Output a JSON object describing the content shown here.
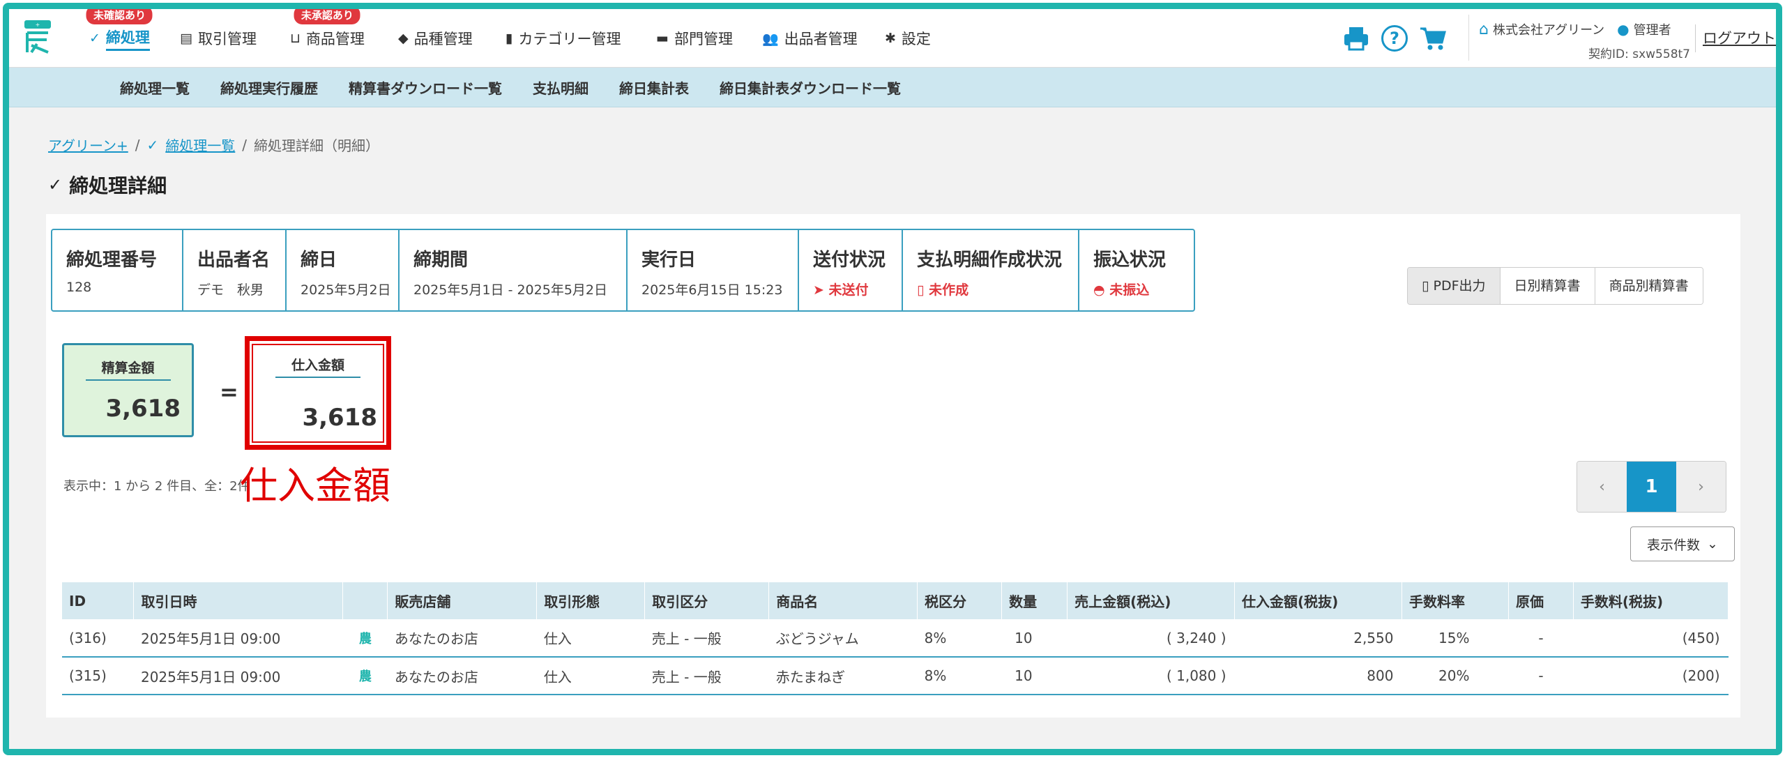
{
  "nav": {
    "items": [
      {
        "label": "締処理",
        "badge": "未確認あり",
        "icon": "check-circle-icon"
      },
      {
        "label": "取引管理",
        "badge": "",
        "icon": "list-icon"
      },
      {
        "label": "商品管理",
        "badge": "未承認あり",
        "icon": "basket-icon"
      },
      {
        "label": "品種管理",
        "badge": "",
        "icon": "tag-icon"
      },
      {
        "label": "カテゴリー管理",
        "badge": "",
        "icon": "bookmark-icon"
      },
      {
        "label": "部門管理",
        "badge": "",
        "icon": "folder-icon"
      },
      {
        "label": "出品者管理",
        "badge": "",
        "icon": "users-icon"
      },
      {
        "label": "設定",
        "badge": "",
        "icon": "gear-icon"
      }
    ]
  },
  "account": {
    "company": "株式会社アグリーン",
    "role": "管理者",
    "contract_id": "契約ID: sxw558t7",
    "logout": "ログアウト"
  },
  "subnav": [
    "締処理一覧",
    "締処理実行履歴",
    "精算書ダウンロード一覧",
    "支払明細",
    "締日集計表",
    "締日集計表ダウンロード一覧"
  ],
  "breadcrumb": {
    "root": "アグリーン+",
    "list": "締処理一覧",
    "current": "締処理詳細（明細）"
  },
  "page_title": "締処理詳細",
  "info": [
    {
      "head": "締処理番号",
      "val": "128"
    },
    {
      "head": "出品者名",
      "val": "デモ　秋男"
    },
    {
      "head": "締日",
      "val": "2025年5月2日"
    },
    {
      "head": "締期間",
      "val": "2025年5月1日 - 2025年5月2日"
    },
    {
      "head": "実行日",
      "val": "2025年6月15日 15:23"
    },
    {
      "head": "送付状況",
      "val": "未送付"
    },
    {
      "head": "支払明細作成状況",
      "val": "未作成"
    },
    {
      "head": "振込状況",
      "val": "未振込"
    }
  ],
  "buttons": [
    "PDF出力",
    "日別精算書",
    "商品別精算書"
  ],
  "summary": {
    "seisan_label": "精算金額",
    "seisan_value": "3,618",
    "eq": "=",
    "shiire_label": "仕入金額",
    "shiire_value": "3,618",
    "annotation": "仕入金額"
  },
  "count_text": "表示中：1 から 2 件目、全：2件",
  "pager": {
    "prev": "‹",
    "current": "1",
    "next": "›"
  },
  "perpage": "表示件数",
  "table": {
    "headers": [
      "ID",
      "取引日時",
      "",
      "販売店舗",
      "取引形態",
      "取引区分",
      "商品名",
      "税区分",
      "数量",
      "売上金額(税込)",
      "仕入金額(税抜)",
      "手数料率",
      "原価",
      "手数料(税抜)"
    ],
    "rows": [
      [
        "(316)",
        "2025年5月1日 09:00",
        "農",
        "あなたのお店",
        "仕入",
        "売上 - 一般",
        "ぶどうジャム",
        "8%",
        "10",
        "( 3,240 )",
        "2,550",
        "15%",
        "-",
        "(450)"
      ],
      [
        "(315)",
        "2025年5月1日 09:00",
        "農",
        "あなたのお店",
        "仕入",
        "売上 - 一般",
        "赤たまねぎ",
        "8%",
        "10",
        "( 1,080 )",
        "800",
        "20%",
        "-",
        "(200)"
      ]
    ]
  },
  "colors": {
    "accent": "#1795c8",
    "frame": "#1fb5ad",
    "alert": "#e0383e",
    "annotation": "#e00000"
  }
}
